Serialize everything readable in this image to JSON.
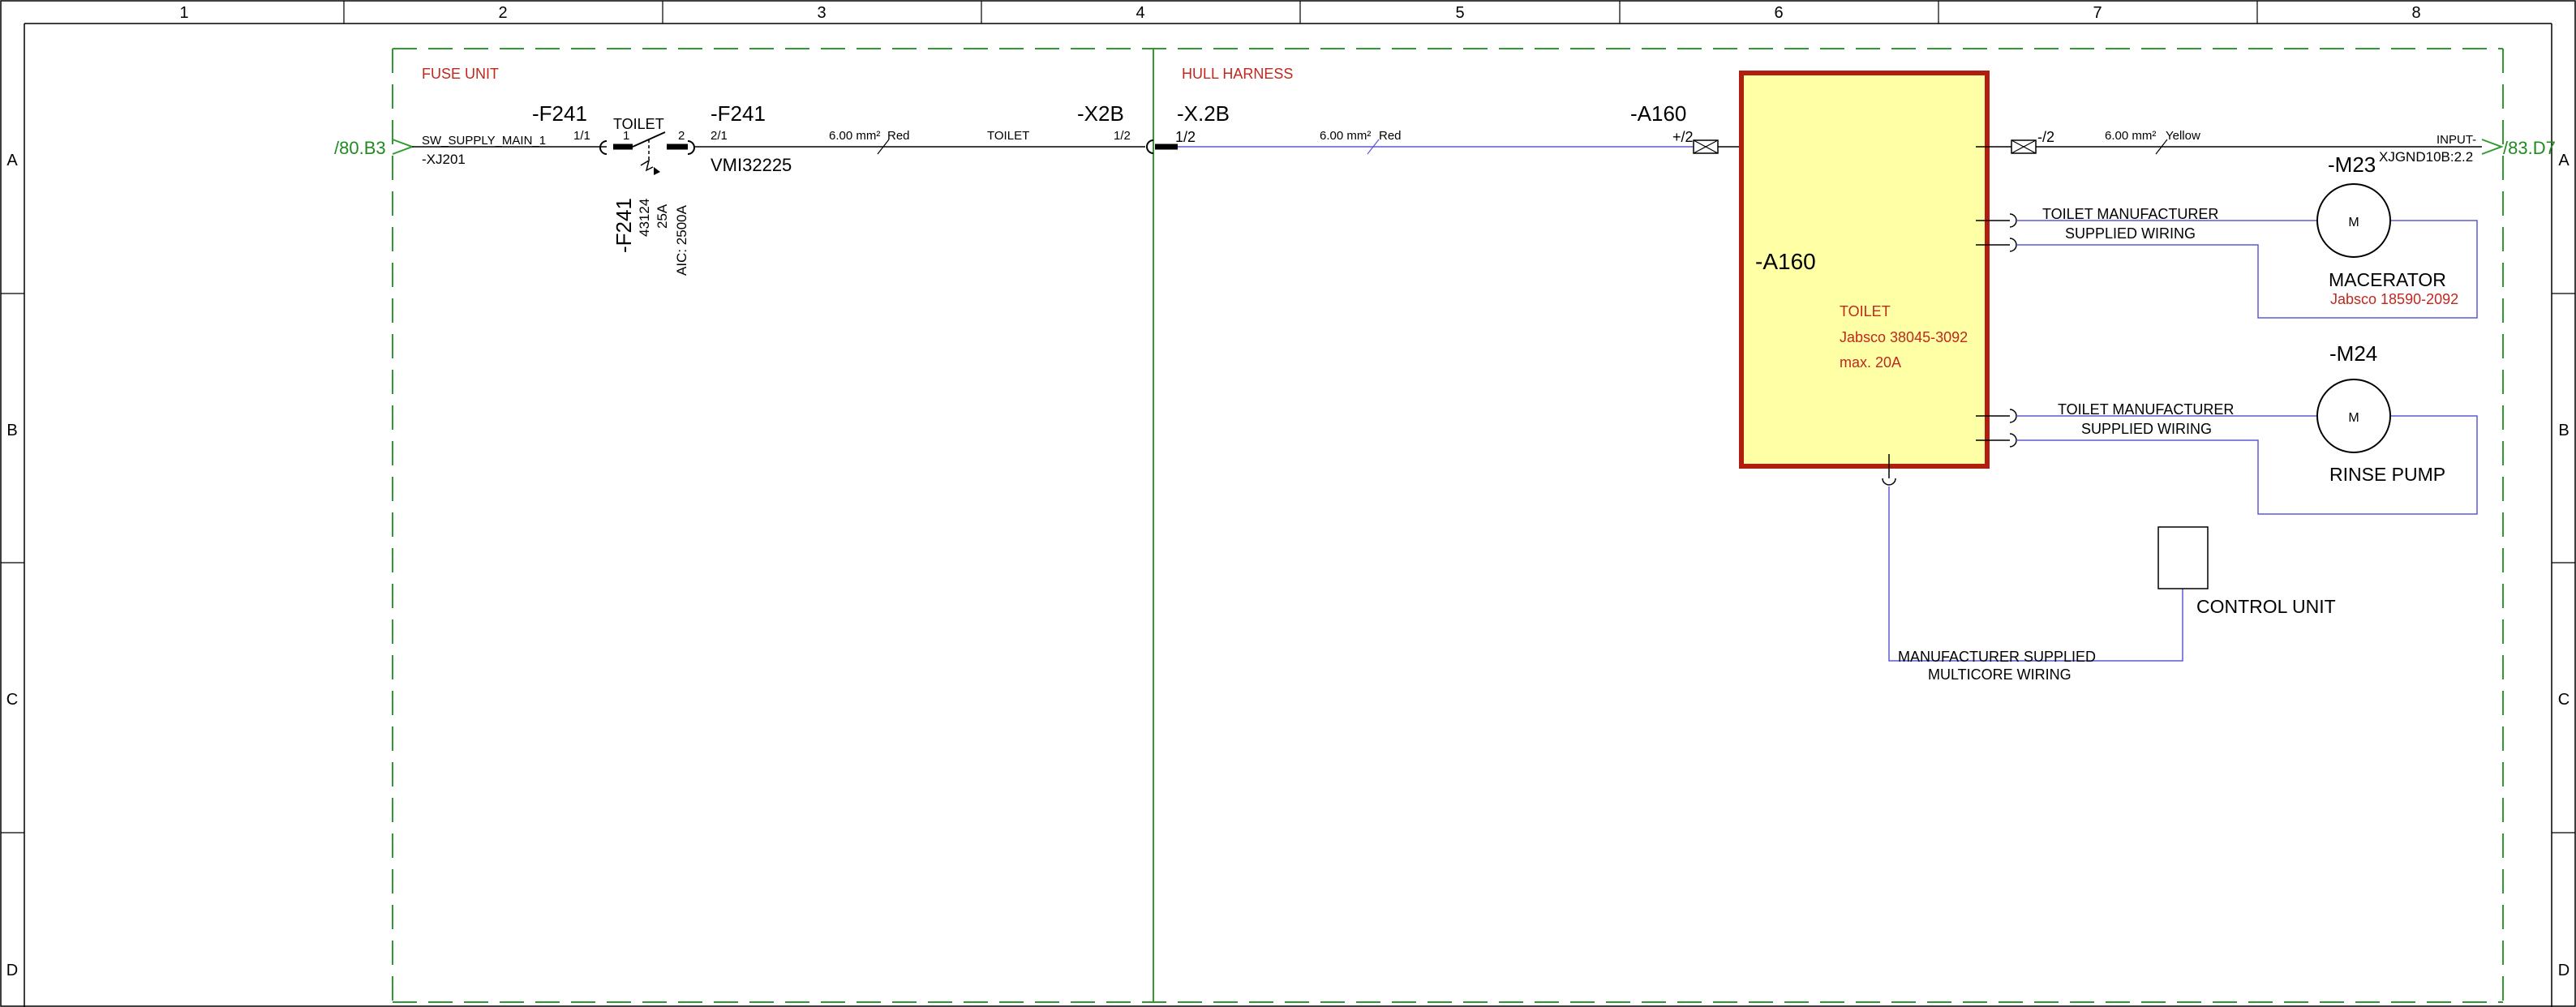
{
  "frame": {
    "columns": [
      "1",
      "2",
      "3",
      "4",
      "5",
      "6",
      "7",
      "8"
    ],
    "rows": [
      "A",
      "B",
      "C",
      "D"
    ]
  },
  "regions": {
    "fuse_unit": "FUSE UNIT",
    "hull_harness": "HULL HARNESS"
  },
  "refs": {
    "incoming": "/80.B3",
    "outgoing": "/83.D7"
  },
  "fuse": {
    "tag_left": "-F241",
    "tag_right": "-F241",
    "contact_label": "TOILET",
    "pin_left": "1",
    "pin_right": "2",
    "conn_in": "1/1",
    "conn_out": "2/1",
    "part_number": "VMI32225",
    "vertical_tag": "-F241",
    "vertical_code": "43124",
    "vertical_rating": "25A",
    "vertical_aic": "AIC: 2500A"
  },
  "supply": {
    "signal": "SW_SUPPLY_MAIN_1",
    "connector": "-XJ201"
  },
  "wire1": {
    "size": "6.00 mm²",
    "color": "Red",
    "label": "TOILET"
  },
  "x2b": {
    "tag": "-X2B",
    "pin": "1/2"
  },
  "x2b_dot": {
    "tag": "-X.2B",
    "pin": "1/2"
  },
  "wire2": {
    "size": "6.00 mm²",
    "color": "Red"
  },
  "a160": {
    "top_tag": "-A160",
    "pin_plus": "+/2",
    "pin_minus": "-/2",
    "inner_tag": "-A160",
    "name": "TOILET",
    "model": "Jabsco 38045-3092",
    "rating": "max. 20A"
  },
  "wire3": {
    "size": "6.00 mm²",
    "color": "Yellow",
    "dest": "INPUT-",
    "dest_ref": "XJGND10B:2.2"
  },
  "m23": {
    "tag": "-M23",
    "symbol": "M",
    "name": "MACERATOR",
    "model": "Jabsco 18590-2092",
    "wiring_line1": "TOILET MANUFACTURER",
    "wiring_line2": "SUPPLIED WIRING"
  },
  "m24": {
    "tag": "-M24",
    "symbol": "M",
    "name": "RINSE PUMP",
    "wiring_line1": "TOILET MANUFACTURER",
    "wiring_line2": "SUPPLIED WIRING"
  },
  "control_unit": {
    "name": "CONTROL UNIT",
    "wiring_line1": "MANUFACTURER SUPPLIED",
    "wiring_line2": "MULTICORE WIRING"
  },
  "colors": {
    "wire": "#5b5bd6",
    "region_border": "#2f9a2f",
    "ref_text": "#1f8a1f",
    "accent_text": "#c0281e",
    "device_fill": "#ffffa6",
    "device_border": "#b01e10"
  }
}
